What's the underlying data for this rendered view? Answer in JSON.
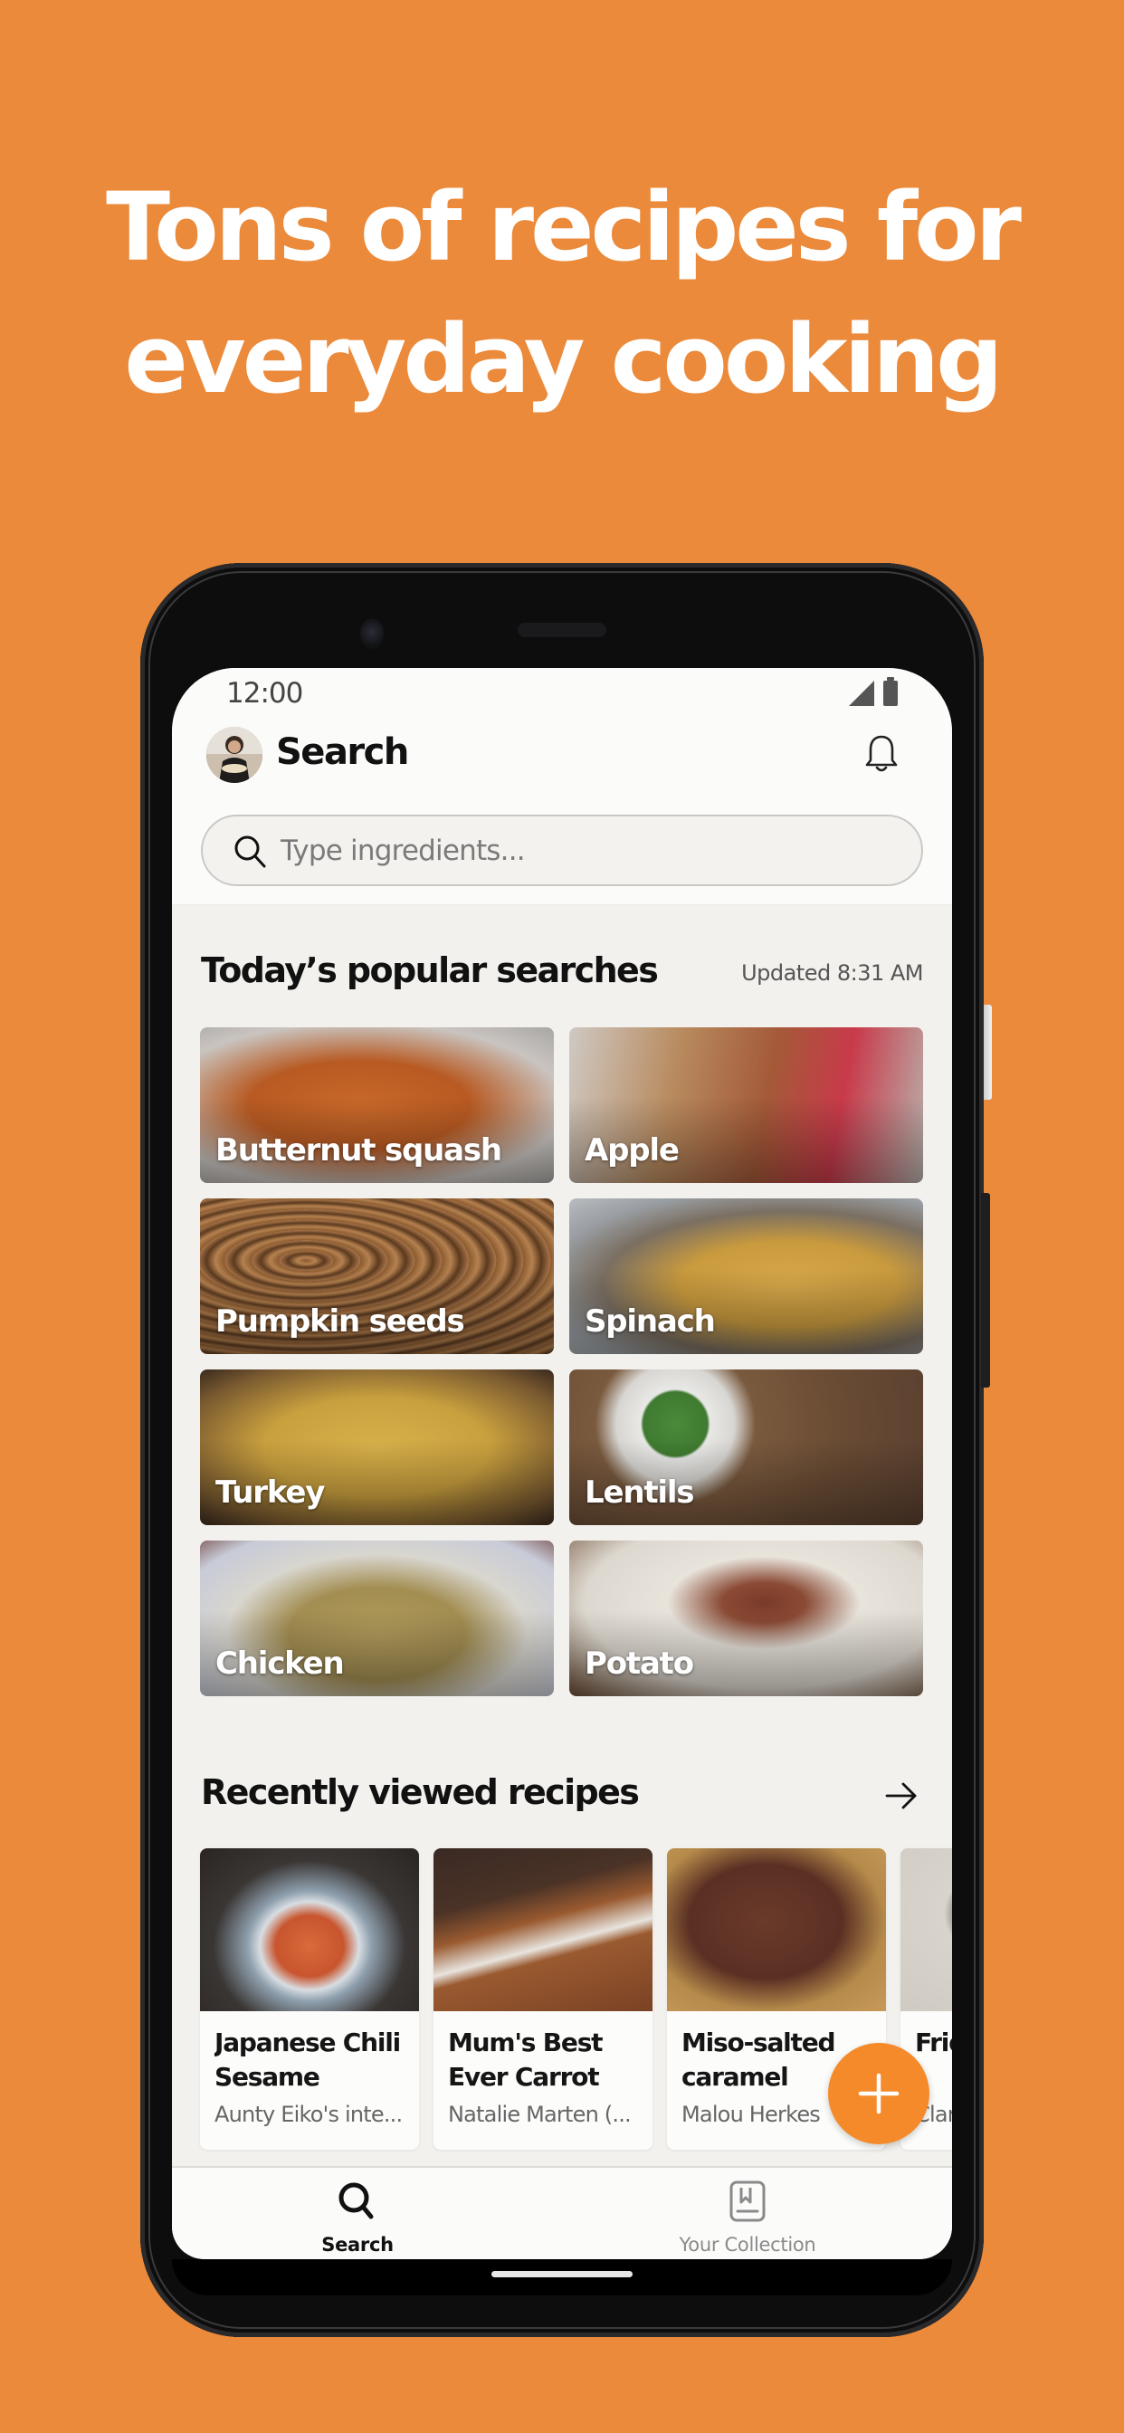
{
  "headline": {
    "line1": "Tons of recipes for",
    "line2": "everyday cooking"
  },
  "colors": {
    "background": "#EB8A3A",
    "accent": "#F58A2B",
    "screen_bg": "#F3F1ED"
  },
  "status_bar": {
    "time": "12:00",
    "icons": [
      "signal-icon",
      "battery-icon"
    ]
  },
  "header": {
    "title": "Search",
    "avatar": "user-avatar",
    "notification_icon": "bell-icon"
  },
  "search": {
    "placeholder": "Type ingredients...",
    "value": "",
    "icon": "search-icon"
  },
  "popular": {
    "title": "Today’s popular searches",
    "updated": "Updated 8:31 AM",
    "items": [
      {
        "label": "Butternut squash"
      },
      {
        "label": "Apple"
      },
      {
        "label": "Pumpkin seeds"
      },
      {
        "label": "Spinach"
      },
      {
        "label": "Turkey"
      },
      {
        "label": "Lentils"
      },
      {
        "label": "Chicken"
      },
      {
        "label": "Potato"
      }
    ]
  },
  "recent": {
    "title": "Recently viewed recipes",
    "more_icon": "arrow-right-icon",
    "items": [
      {
        "title": "Japanese Chili Sesame Ram...",
        "author": "Aunty Eiko's inte..."
      },
      {
        "title": "Mum's Best Ever Carrot C...",
        "author": "Natalie Marten (..."
      },
      {
        "title": "Miso-salted caramel brow...",
        "author": "Malou Herkes"
      },
      {
        "title": "Frid pr",
        "author": "Clar"
      }
    ]
  },
  "fab": {
    "icon": "plus-icon"
  },
  "bottom_nav": {
    "items": [
      {
        "label": "Search",
        "icon": "search-icon",
        "active": true
      },
      {
        "label": "Your Collection",
        "icon": "collection-icon",
        "active": false
      }
    ]
  }
}
